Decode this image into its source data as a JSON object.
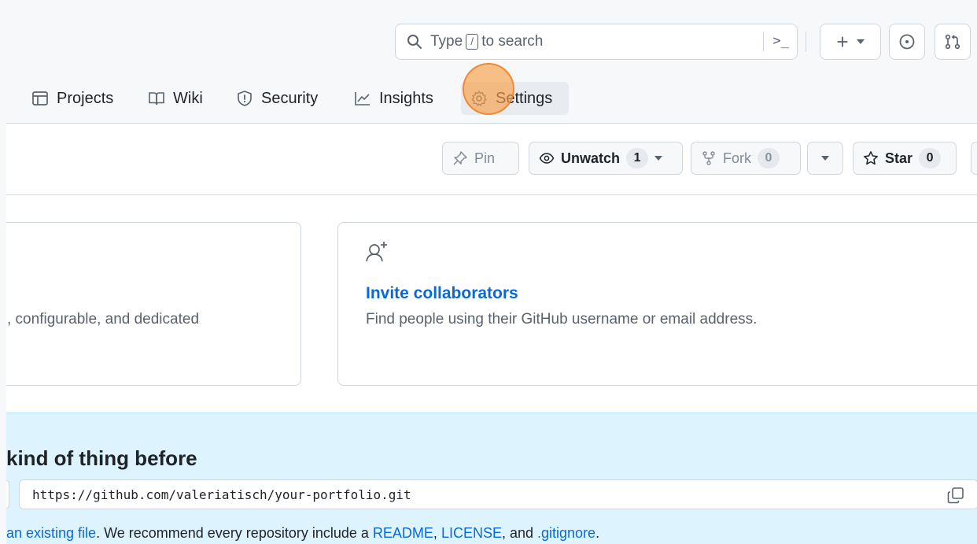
{
  "header": {
    "search": {
      "prefix": "Type",
      "kbd": "/",
      "suffix": "to search",
      "command_glyph": ">_"
    }
  },
  "nav": {
    "tabs": [
      {
        "label": "Projects"
      },
      {
        "label": "Wiki"
      },
      {
        "label": "Security"
      },
      {
        "label": "Insights"
      },
      {
        "label": "Settings",
        "selected": true
      }
    ]
  },
  "repo_actions": {
    "pin_label": "Pin",
    "unwatch_label": "Unwatch",
    "unwatch_count": "1",
    "fork_label": "Fork",
    "fork_count": "0",
    "star_label": "Star",
    "star_count": "0"
  },
  "cards": {
    "left_desc": ", configurable, and dedicated",
    "right_title": "Invite collaborators",
    "right_desc": "Find people using their GitHub username or email address."
  },
  "quick_setup": {
    "heading": "kind of thing before",
    "url": "https://github.com/valeriatisch/your-portfolio.git",
    "help": {
      "link1": "an existing file",
      "text1": ". We recommend every repository include a ",
      "link2": "README",
      "text2": ", ",
      "link3": "LICENSE",
      "text3": ", and ",
      "link4": ".gitignore",
      "text4": "."
    }
  },
  "colors": {
    "accent": "#0969da",
    "setup_bg": "#ddf4ff",
    "click_marker": "#f7a046"
  }
}
